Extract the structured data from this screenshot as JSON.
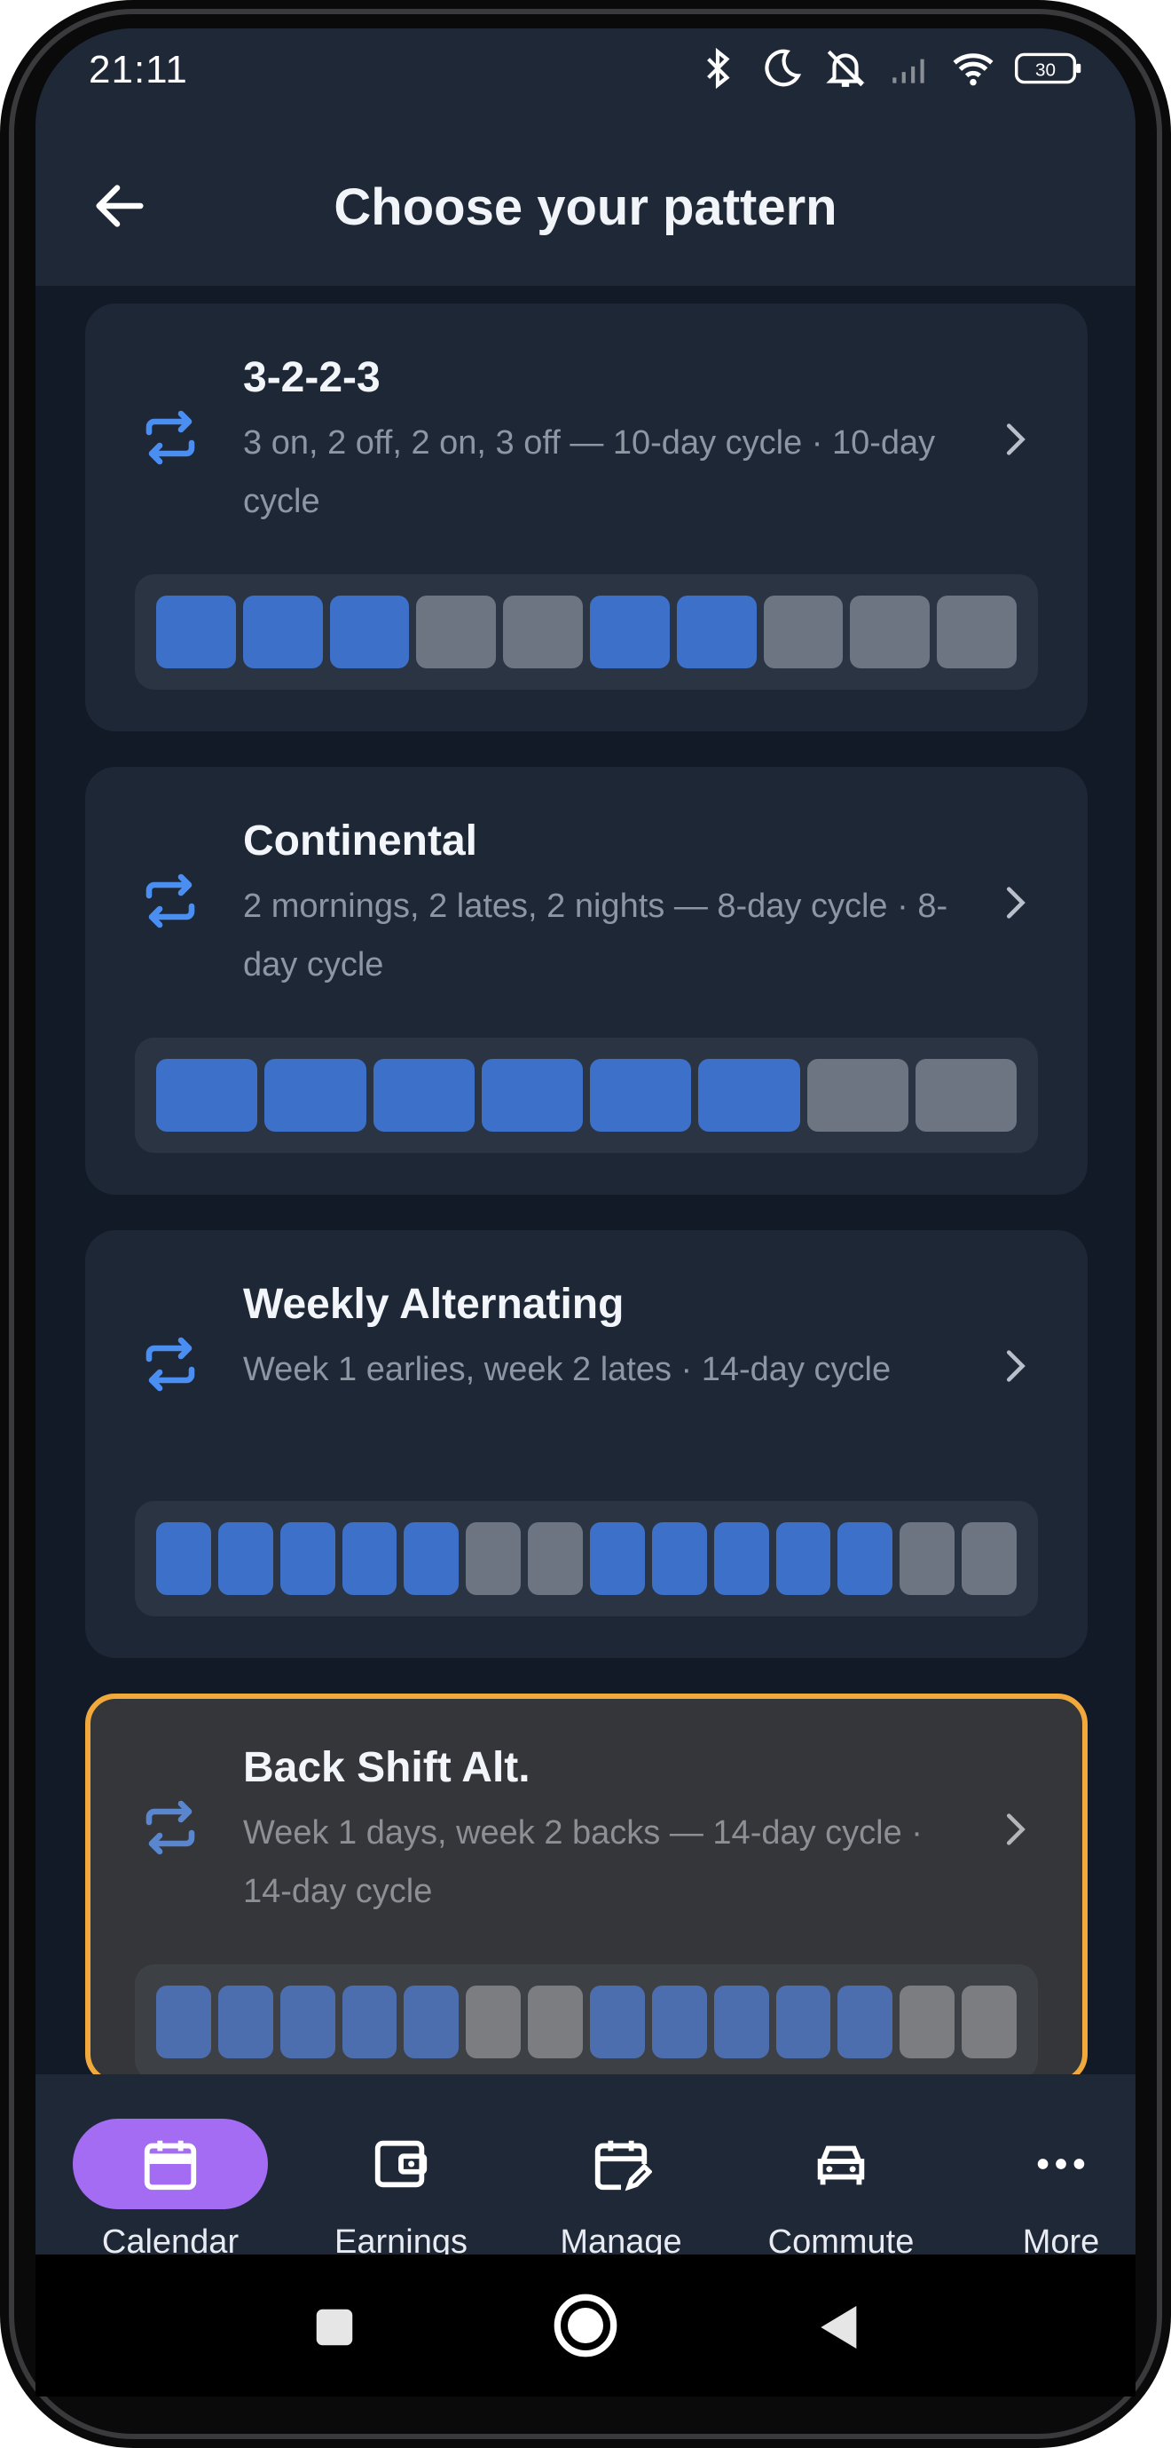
{
  "status_bar": {
    "time": "21:11",
    "battery": "30",
    "icons": [
      "bluetooth-icon",
      "moon-icon",
      "muted-bell-icon",
      "signal-icon",
      "wifi-icon",
      "battery-icon"
    ]
  },
  "header": {
    "title": "Choose your pattern",
    "back_icon": "arrow-left-icon"
  },
  "colors": {
    "on_day": "#3c70c9",
    "off_day": "#6d7482",
    "accent": "#a36cf2",
    "selection_border": "#f0a93a"
  },
  "patterns": [
    {
      "name": "3-2-2-3",
      "desc": "3 on, 2 off, 2 on, 3 off — 10-day cycle · 10-day cycle",
      "days": [
        1,
        1,
        1,
        0,
        0,
        1,
        1,
        0,
        0,
        0
      ]
    },
    {
      "name": "Continental",
      "desc": "2 mornings, 2 lates, 2 nights — 8-day cycle · 8-day cycle",
      "days": [
        1,
        1,
        1,
        1,
        1,
        1,
        0,
        0
      ]
    },
    {
      "name": "Weekly Alternating",
      "desc": "Week 1 earlies, week 2 lates · 14-day cycle",
      "days": [
        1,
        1,
        1,
        1,
        1,
        0,
        0,
        1,
        1,
        1,
        1,
        1,
        0,
        0
      ]
    },
    {
      "name": "Back Shift Alt.",
      "desc": "Week 1 days, week 2 backs — 14-day cycle · 14-day cycle",
      "days": [
        1,
        1,
        1,
        1,
        1,
        0,
        0,
        1,
        1,
        1,
        1,
        1,
        0,
        0
      ],
      "selected": true
    }
  ],
  "bottom_nav": [
    {
      "label": "Calendar",
      "icon": "calendar-icon",
      "active": true
    },
    {
      "label": "Earnings",
      "icon": "wallet-icon"
    },
    {
      "label": "Manage",
      "icon": "calendar-edit-icon"
    },
    {
      "label": "Commute",
      "icon": "car-icon"
    },
    {
      "label": "More",
      "icon": "more-dots-icon"
    }
  ]
}
